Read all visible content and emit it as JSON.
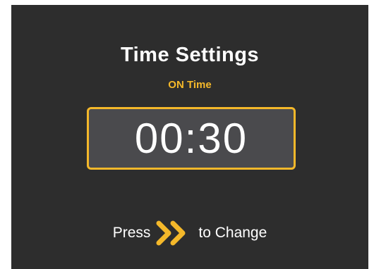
{
  "screen": {
    "title": "Time Settings",
    "subtitle": "ON Time",
    "time_value": "00:30",
    "hint": {
      "press_label": "Press",
      "icon": "double-chevron-right-icon",
      "change_label": "to Change"
    }
  },
  "colors": {
    "background": "#2d2d2d",
    "accent": "#f4b82a",
    "time_box_fill": "#4a4a4d",
    "text": "#ffffff"
  }
}
